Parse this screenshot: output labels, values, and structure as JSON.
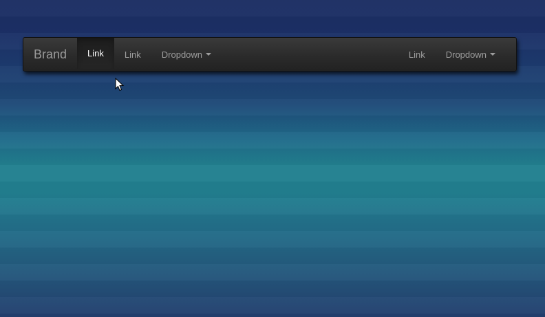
{
  "navbar": {
    "brand": "Brand",
    "left_items": [
      {
        "label": "Link",
        "active": true
      },
      {
        "label": "Link",
        "active": false
      },
      {
        "label": "Dropdown",
        "dropdown": true
      }
    ],
    "right_items": [
      {
        "label": "Link"
      },
      {
        "label": "Dropdown",
        "dropdown": true
      }
    ]
  },
  "icons": {
    "caret": "caret-down-icon",
    "cursor": "mouse-pointer-icon"
  },
  "colors": {
    "navbar_bg": "#2b2b2b",
    "active_text": "#ffffff",
    "inactive_text": "#9d9d9d",
    "background_top": "#1c2e63",
    "background_middle": "#22808f"
  }
}
